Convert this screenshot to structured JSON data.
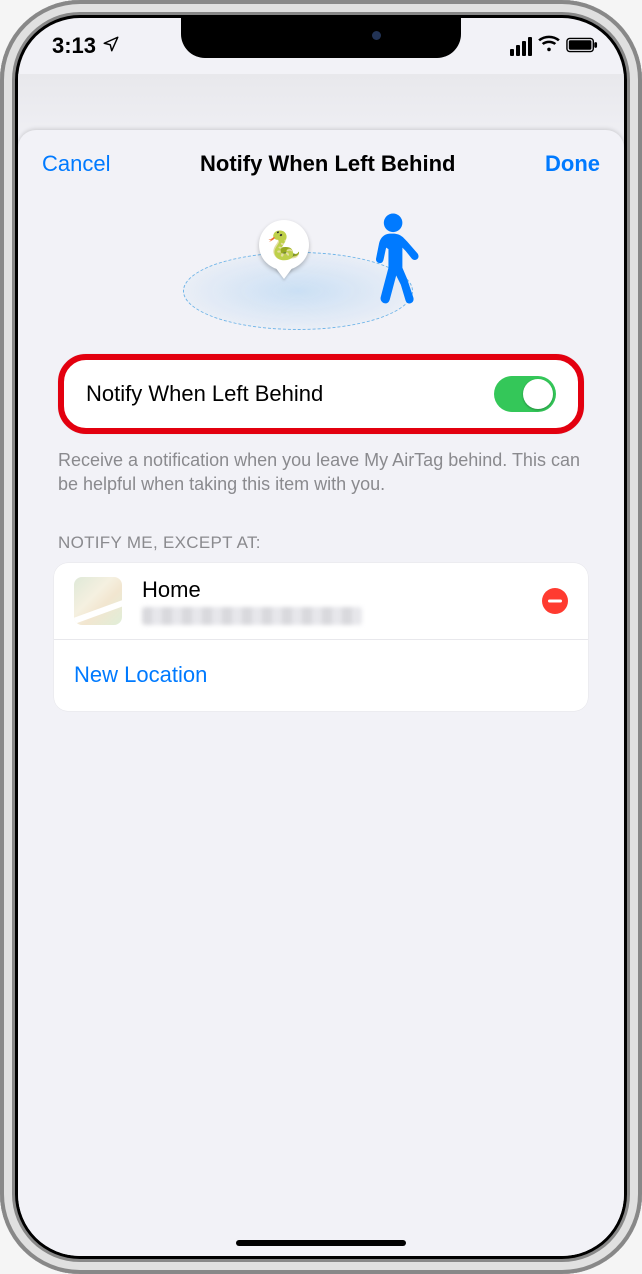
{
  "status": {
    "time": "3:13",
    "location_icon": "location-arrow",
    "signal_bars": 4,
    "wifi": true,
    "battery_full": true
  },
  "nav": {
    "cancel": "Cancel",
    "title": "Notify When Left Behind",
    "done": "Done"
  },
  "illustration": {
    "item_icon": "🐍",
    "walker_icon": "person-walking"
  },
  "toggle": {
    "label": "Notify When Left Behind",
    "on": true,
    "highlighted": true,
    "highlight_color": "#e3000f",
    "switch_color": "#34c759"
  },
  "description": "Receive a notification when you leave My AirTag behind. This can be helpful when taking this item with you.",
  "exceptions": {
    "header": "NOTIFY ME, EXCEPT AT:",
    "items": [
      {
        "title": "Home",
        "subtitle_redacted": true,
        "remove": true
      }
    ],
    "new_label": "New Location"
  },
  "colors": {
    "accent": "#007aff",
    "destructive": "#ff3b30",
    "background": "#f2f2f7"
  }
}
